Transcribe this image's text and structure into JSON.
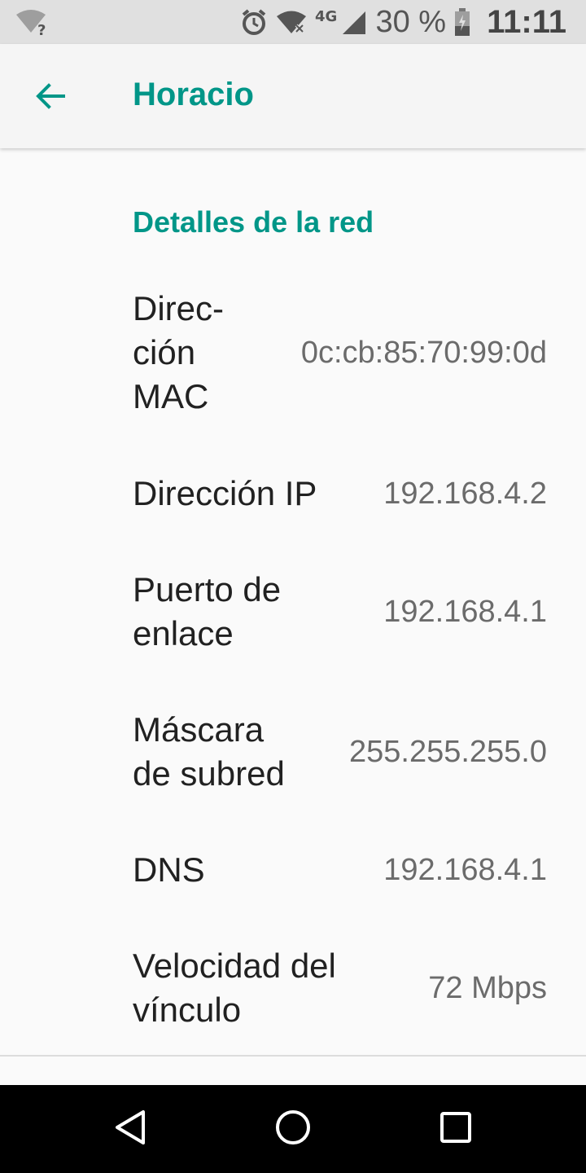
{
  "status_bar": {
    "left_icon": "wifi-question-icon",
    "icons": [
      "alarm-icon",
      "wifi-off-icon",
      "signal-4g-icon"
    ],
    "network_type": "4G",
    "battery_percent": "30 %",
    "battery_icon": "battery-charging-icon",
    "time": "11:11"
  },
  "app_bar": {
    "back_icon": "arrow-back-icon",
    "title": "Horacio",
    "accent_color": "#009688"
  },
  "section": {
    "title": "Detalles de la red"
  },
  "details": [
    {
      "label": "Direc-\nción\nMAC",
      "value": "0c:cb:85:70:99:0d"
    },
    {
      "label": "Dirección IP",
      "value": "192.168.4.2"
    },
    {
      "label": "Puerto de\nenlace",
      "value": "192.168.4.1"
    },
    {
      "label": "Máscara\nde subred",
      "value": "255.255.255.0"
    },
    {
      "label": "DNS",
      "value": "192.168.4.1"
    },
    {
      "label": "Velocidad del\nvínculo",
      "value": "72 Mbps"
    }
  ],
  "nav_bar": {
    "items": [
      "back-icon",
      "home-icon",
      "recents-icon"
    ]
  }
}
